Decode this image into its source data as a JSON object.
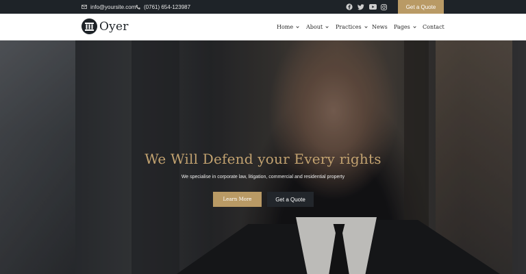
{
  "topbar": {
    "email": "info@yoursite.com",
    "phone": "(0761) 654-123987",
    "quote_button": "Get a Quote",
    "social": [
      "facebook-icon",
      "twitter-icon",
      "youtube-icon",
      "instagram-icon"
    ]
  },
  "brand": {
    "name": "Oyer"
  },
  "nav": {
    "items": [
      {
        "label": "Home",
        "dropdown": true
      },
      {
        "label": "About",
        "dropdown": true
      },
      {
        "label": "Practices",
        "dropdown": true
      },
      {
        "label": "News",
        "dropdown": false
      },
      {
        "label": "Pages",
        "dropdown": true
      },
      {
        "label": "Contact",
        "dropdown": false
      }
    ]
  },
  "hero": {
    "title": "We Will Defend your Every rights",
    "subtitle": "We specialise in corporate law, litigation, commercial and residential property",
    "primary_button": "Learn More",
    "secondary_button": "Get a Quote"
  },
  "colors": {
    "accent": "#b99a65",
    "dark": "#1e2328",
    "title": "#c2a270"
  }
}
